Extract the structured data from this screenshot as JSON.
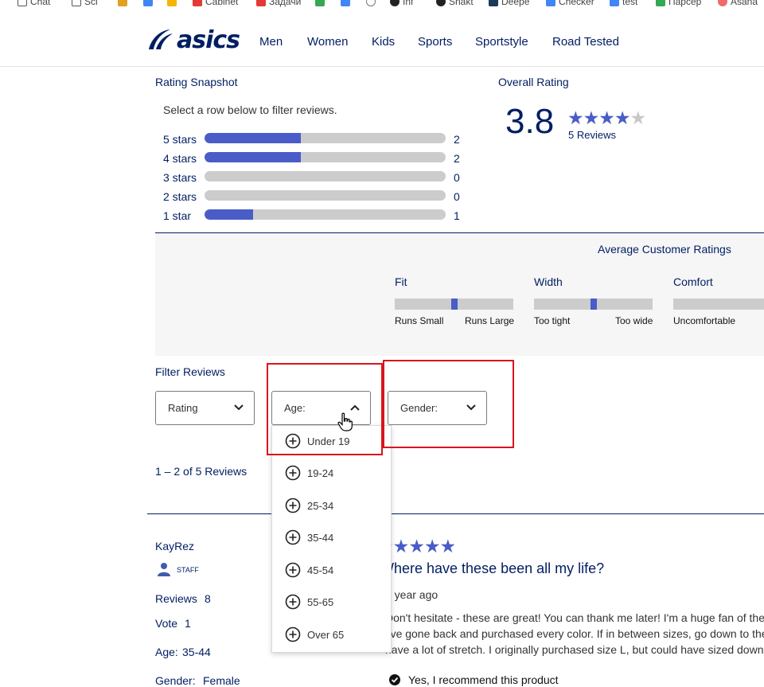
{
  "bookmarks": [
    "Chat",
    "Sci",
    "Cabinet",
    "Задачи",
    "Inf",
    "Snakt",
    "Deepe",
    "Checker",
    "test",
    "Парсер",
    "Asana"
  ],
  "colors": {
    "brand_navy": "#001e62",
    "rating_blue": "#4a5cc7",
    "track_gray": "#cccccc",
    "highlight_red": "#d9141e"
  },
  "header": {
    "logo_text": "asics",
    "nav": [
      "Men",
      "Women",
      "Kids",
      "Sports",
      "Sportstyle",
      "Road Tested"
    ]
  },
  "snapshot": {
    "title": "Rating Snapshot",
    "hint": "Select a row below to filter reviews.",
    "rows": [
      {
        "label": "5 stars",
        "count": "2",
        "fraction": 0.4
      },
      {
        "label": "4 stars",
        "count": "2",
        "fraction": 0.4
      },
      {
        "label": "3 stars",
        "count": "0",
        "fraction": 0
      },
      {
        "label": "2 stars",
        "count": "0",
        "fraction": 0
      },
      {
        "label": "1 star",
        "count": "1",
        "fraction": 0.2
      }
    ]
  },
  "overall": {
    "title": "Overall Rating",
    "score": "3.8",
    "stars_filled": 4,
    "reviews_link": "5 Reviews"
  },
  "avg_ratings": {
    "title": "Average Customer Ratings",
    "scales": [
      {
        "name": "Fit",
        "low": "Runs Small",
        "high": "Runs Large",
        "value": 0.5
      },
      {
        "name": "Width",
        "low": "Too tight",
        "high": "Too wide",
        "value": 0.5
      },
      {
        "name": "Comfort",
        "low": "Uncomfortable",
        "high": "",
        "value": null
      }
    ]
  },
  "filters": {
    "title": "Filter Reviews",
    "rating_label": "Rating",
    "age_label": "Age:",
    "gender_label": "Gender:",
    "age_options": [
      "Under 19",
      "19-24",
      "25-34",
      "35-44",
      "45-54",
      "55-65",
      "Over 65"
    ]
  },
  "results": {
    "summary": "1 – 2 of 5 Reviews"
  },
  "review": {
    "author": "KayRez",
    "badge": "STAFF",
    "reviews_label": "Reviews",
    "reviews_count": "8",
    "vote_label": "Vote",
    "vote_count": "1",
    "age_label": "Age:",
    "age_value": "35-44",
    "gender_label": "Gender:",
    "gender_value": "Female",
    "stars": 5,
    "title": "Where have these been all my life?",
    "date": "1 year ago",
    "body_lines": [
      "Don't hesitate - these are great! You can thank me later! I'm a huge fan of these",
      "I've gone back and purchased every color. If in between sizes, go down to the",
      "have a lot of stretch. I originally purchased size L, but could have sized down"
    ],
    "recommend": "Yes, I recommend this product"
  }
}
